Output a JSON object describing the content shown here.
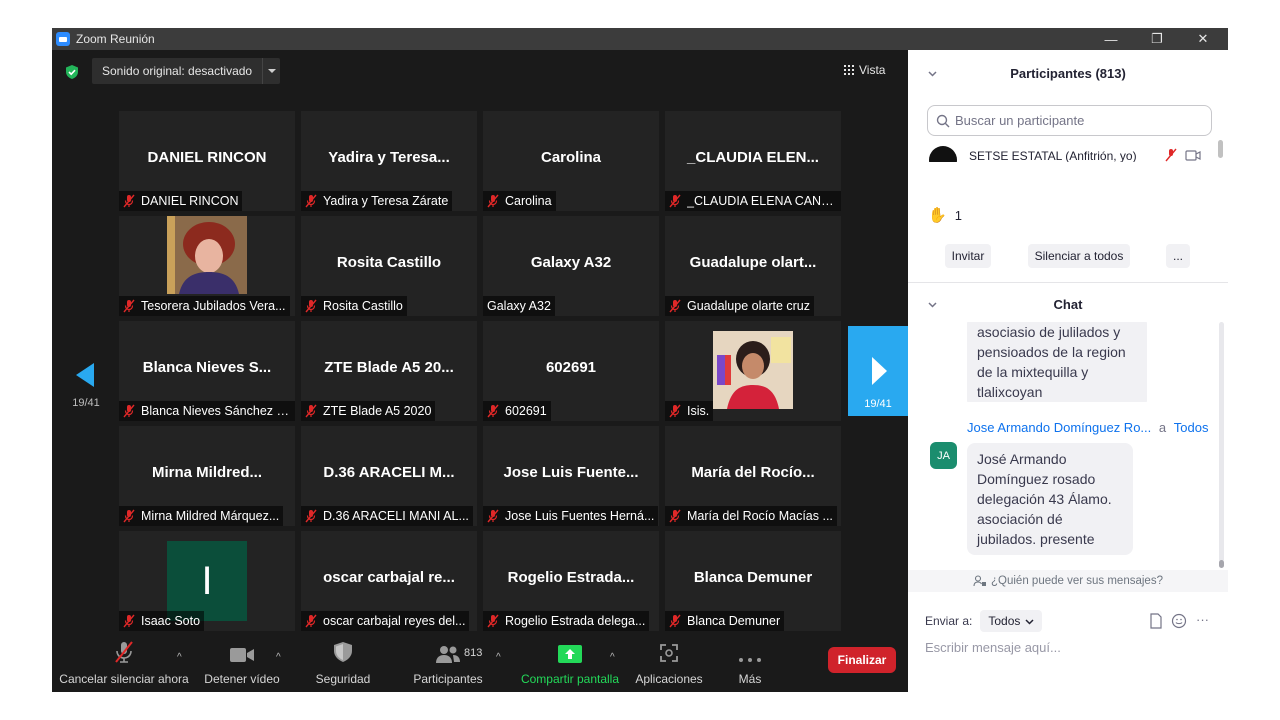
{
  "window": {
    "title": "Zoom Reunión",
    "minimize": "—",
    "restore": "❐",
    "close": "✕"
  },
  "meeting_bar": {
    "audio_label": "Sonido original: desactivado",
    "view_label": "Vista"
  },
  "tiles": [
    {
      "big": "DANIEL RINCON",
      "tag": "DANIEL RINCON",
      "muted": true
    },
    {
      "big": "Yadira y Teresa...",
      "tag": "Yadira y Teresa Zárate",
      "muted": true
    },
    {
      "big": "Carolina",
      "tag": "Carolina",
      "muted": true
    },
    {
      "big": "_CLAUDIA ELEN...",
      "tag": "_CLAUDIA ELENA CANAL...",
      "muted": true
    },
    {
      "big": "",
      "tag": "Tesorera Jubilados Vera...",
      "muted": true,
      "photo": "woman-red-hair"
    },
    {
      "big": "Rosita Castillo",
      "tag": "Rosita Castillo",
      "muted": true
    },
    {
      "big": "Galaxy A32",
      "tag": "Galaxy A32",
      "muted": false
    },
    {
      "big": "Guadalupe  olart...",
      "tag": "Guadalupe olarte cruz",
      "muted": true
    },
    {
      "big": "Blanca Nieves S...",
      "tag": "Blanca Nieves Sánchez F...",
      "muted": true
    },
    {
      "big": "ZTE Blade A5 20...",
      "tag": "ZTE Blade A5 2020",
      "muted": true
    },
    {
      "big": "602691",
      "tag": "602691",
      "muted": true
    },
    {
      "big": "",
      "tag": "Isis.",
      "muted": true,
      "photo": "woman-classroom"
    },
    {
      "big": "Mirna  Mildred...",
      "tag": "Mirna Mildred Márquez...",
      "muted": true
    },
    {
      "big": "D.36 ARACELI M...",
      "tag": "D.36 ARACELI MANI AL...",
      "muted": true
    },
    {
      "big": "Jose Luis Fuente...",
      "tag": "Jose Luis Fuentes Herná...",
      "muted": true
    },
    {
      "big": "María  del  Rocío...",
      "tag": "María del Rocío Macías ...",
      "muted": true
    },
    {
      "big": "",
      "tag": "Isaac Soto",
      "muted": true,
      "avatar_letter": "I"
    },
    {
      "big": "oscar  carbajal  re...",
      "tag": "oscar carbajal reyes del...",
      "muted": true
    },
    {
      "big": "Rogelio  Estrada...",
      "tag": "Rogelio Estrada delega...",
      "muted": true
    },
    {
      "big": "Blanca Demuner",
      "tag": "Blanca Demuner",
      "muted": true
    }
  ],
  "pagination": {
    "left": "19/41",
    "right": "19/41"
  },
  "toolbar": {
    "unmute": "Cancelar silenciar ahora",
    "video": "Detener vídeo",
    "security": "Seguridad",
    "participants": "Participantes",
    "participants_count": "813",
    "share": "Compartir pantalla",
    "apps": "Aplicaciones",
    "more": "Más",
    "end": "Finalizar"
  },
  "participants_panel": {
    "title": "Participantes (813)",
    "search_placeholder": "Buscar un participante",
    "host": "SETSE ESTATAL (Anfitrión, yo)",
    "raised_hands": "1",
    "invite": "Invitar",
    "mute_all": "Silenciar a todos",
    "more": "..."
  },
  "chat_panel": {
    "title": "Chat",
    "prev_message": "asociasio de julilados y pensioados de la region de la mixtequilla y tlalixcoyan",
    "sender": "Jose Armando Domínguez Ro...",
    "to_word": "a",
    "to_target": "Todos",
    "sender_initials": "JA",
    "message": "José Armando Domínguez rosado delegación 43 Álamo. asociación dé jubilados. presente",
    "who_can_see": "¿Quién puede ver sus mensajes?",
    "send_to_label": "Enviar a:",
    "send_to_value": "Todos",
    "compose_placeholder": "Escribir mensaje aquí...",
    "compose_more": "···"
  },
  "colors": {
    "accent": "#29a9f0",
    "end": "#d0232b",
    "share": "#23d959",
    "muted": "#e02828"
  }
}
